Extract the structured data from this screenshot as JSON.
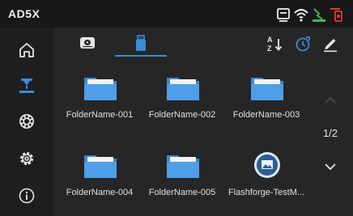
{
  "app": {
    "title": "AD5X"
  },
  "statusbar": {
    "icons": [
      "usb-drive-icon",
      "wifi-icon",
      "print-status-icon",
      "filament-icon"
    ],
    "colors": {
      "wifi": "#ffffff",
      "print_status": "#4caf50",
      "filament": "#e53935"
    }
  },
  "sidebar": {
    "items": [
      {
        "icon": "home-icon",
        "active": false
      },
      {
        "icon": "printer-icon",
        "active": true
      },
      {
        "icon": "spool-icon",
        "active": false
      },
      {
        "icon": "settings-icon",
        "active": false
      },
      {
        "icon": "info-icon",
        "active": false
      }
    ]
  },
  "tabs": [
    {
      "icon": "local-storage-icon",
      "active": false
    },
    {
      "icon": "usb-storage-icon",
      "active": true
    }
  ],
  "toolbar": {
    "sort_icon": "sort-az-icon",
    "history_icon": "history-icon",
    "edit_icon": "edit-icon"
  },
  "files": [
    {
      "name": "FolderName-001",
      "type": "folder"
    },
    {
      "name": "FolderName-002",
      "type": "folder"
    },
    {
      "name": "FolderName-003",
      "type": "folder"
    },
    {
      "name": "FolderName-004",
      "type": "folder"
    },
    {
      "name": "FolderName-005",
      "type": "folder"
    },
    {
      "name": "Flashforge-TestM...",
      "type": "file"
    }
  ],
  "pagination": {
    "page": "1/2"
  },
  "colors": {
    "accent": "#3a8ad8",
    "folder": "#4f9ee8"
  }
}
